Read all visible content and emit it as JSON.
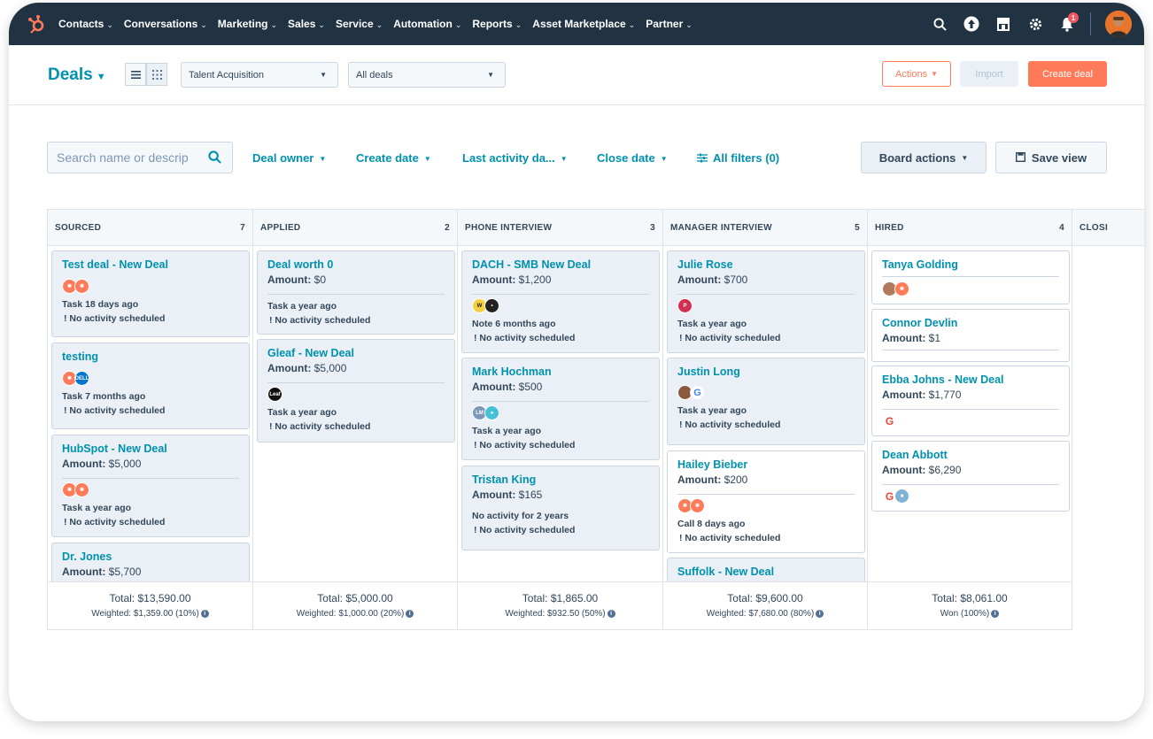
{
  "nav": {
    "items": [
      {
        "label": "Contacts"
      },
      {
        "label": "Conversations"
      },
      {
        "label": "Marketing"
      },
      {
        "label": "Sales"
      },
      {
        "label": "Service"
      },
      {
        "label": "Automation"
      },
      {
        "label": "Reports"
      },
      {
        "label": "Asset Marketplace"
      },
      {
        "label": "Partner"
      }
    ],
    "notification_count": "1"
  },
  "header": {
    "title": "Deals",
    "pipeline_select": "Talent Acquisition",
    "view_select": "All deals",
    "actions_label": "Actions",
    "import_label": "Import",
    "create_label": "Create deal"
  },
  "filters": {
    "search_placeholder": "Search name or descrip",
    "deal_owner": "Deal owner",
    "create_date": "Create date",
    "last_activity": "Last activity da...",
    "close_date": "Close date",
    "all_filters": "All filters (0)",
    "board_actions": "Board actions",
    "save_view": "Save view"
  },
  "columns": [
    {
      "name": "SOURCED",
      "count": "7",
      "total": "Total: $13,590.00",
      "weighted": "Weighted: $1,359.00 (10%)",
      "cards": [
        {
          "title": "Test deal - New Deal",
          "amount_label": "",
          "amount": "",
          "activity": "Task 18 days ago",
          "next": "! No activity scheduled"
        },
        {
          "title": "testing",
          "amount_label": "",
          "amount": "",
          "activity": "Task 7 months ago",
          "next": "! No activity scheduled"
        },
        {
          "title": "HubSpot - New Deal",
          "amount_label": "Amount:",
          "amount": " $5,000",
          "activity": "Task a year ago",
          "next": "! No activity scheduled"
        },
        {
          "title": "Dr. Jones",
          "amount_label": "Amount:",
          "amount": " $5,700",
          "activity": "",
          "next": ""
        }
      ]
    },
    {
      "name": "APPLIED",
      "count": "2",
      "total": "Total: $5,000.00",
      "weighted": "Weighted: $1,000.00 (20%)",
      "cards": [
        {
          "title": "Deal worth 0",
          "amount_label": "Amount:",
          "amount": " $0",
          "activity": "Task a year ago",
          "next": "! No activity scheduled"
        },
        {
          "title": "Gleaf - New Deal",
          "amount_label": "Amount:",
          "amount": " $5,000",
          "activity": "Task a year ago",
          "next": "! No activity scheduled"
        }
      ]
    },
    {
      "name": "PHONE INTERVIEW",
      "count": "3",
      "total": "Total: $1,865.00",
      "weighted": "Weighted: $932.50 (50%)",
      "cards": [
        {
          "title": "DACH - SMB New Deal",
          "amount_label": "Amount:",
          "amount": " $1,200",
          "activity": "Note 6 months ago",
          "next": "! No activity scheduled"
        },
        {
          "title": "Mark Hochman",
          "amount_label": "Amount:",
          "amount": " $500",
          "activity": "Task a year ago",
          "next": "! No activity scheduled"
        },
        {
          "title": "Tristan King",
          "amount_label": "Amount:",
          "amount": " $165",
          "activity": "No activity for 2 years",
          "next": "! No activity scheduled"
        }
      ]
    },
    {
      "name": "MANAGER INTERVIEW",
      "count": "5",
      "total": "Total: $9,600.00",
      "weighted": "Weighted: $7,680.00 (80%)",
      "cards": [
        {
          "title": "Julie Rose",
          "amount_label": "Amount:",
          "amount": " $700",
          "activity": "Task a year ago",
          "next": "! No activity scheduled"
        },
        {
          "title": "Justin Long",
          "amount_label": "",
          "amount": "",
          "activity": "Task a year ago",
          "next": "! No activity scheduled"
        },
        {
          "title": "Hailey Bieber",
          "amount_label": "Amount:",
          "amount": " $200",
          "activity": "Call 8 days ago",
          "next": "! No activity scheduled"
        },
        {
          "title": "Suffolk - New Deal",
          "amount_label": "",
          "amount": "",
          "activity": "",
          "next": ""
        }
      ]
    },
    {
      "name": "HIRED",
      "count": "4",
      "total": "Total: $8,061.00",
      "weighted": "Won (100%)",
      "cards": [
        {
          "title": "Tanya Golding",
          "amount_label": "",
          "amount": "",
          "activity": "",
          "next": ""
        },
        {
          "title": "Connor Devlin",
          "amount_label": "Amount:",
          "amount": " $1",
          "activity": "",
          "next": ""
        },
        {
          "title": "Ebba Johns - New Deal",
          "amount_label": "Amount:",
          "amount": " $1,770",
          "activity": "",
          "next": ""
        },
        {
          "title": "Dean Abbott",
          "amount_label": "Amount:",
          "amount": " $6,290",
          "activity": "",
          "next": ""
        }
      ]
    },
    {
      "name": "CLOSI",
      "count": ""
    }
  ],
  "avatar_text": {
    "leaf": "Leaf",
    "lm": "LM",
    "dell": "DELL",
    "ps": "P"
  },
  "colors": {
    "nav_bg": "#213343",
    "accent": "#ff7a59",
    "link": "#0091ae",
    "hubspot_orange": "#ff7a59"
  }
}
